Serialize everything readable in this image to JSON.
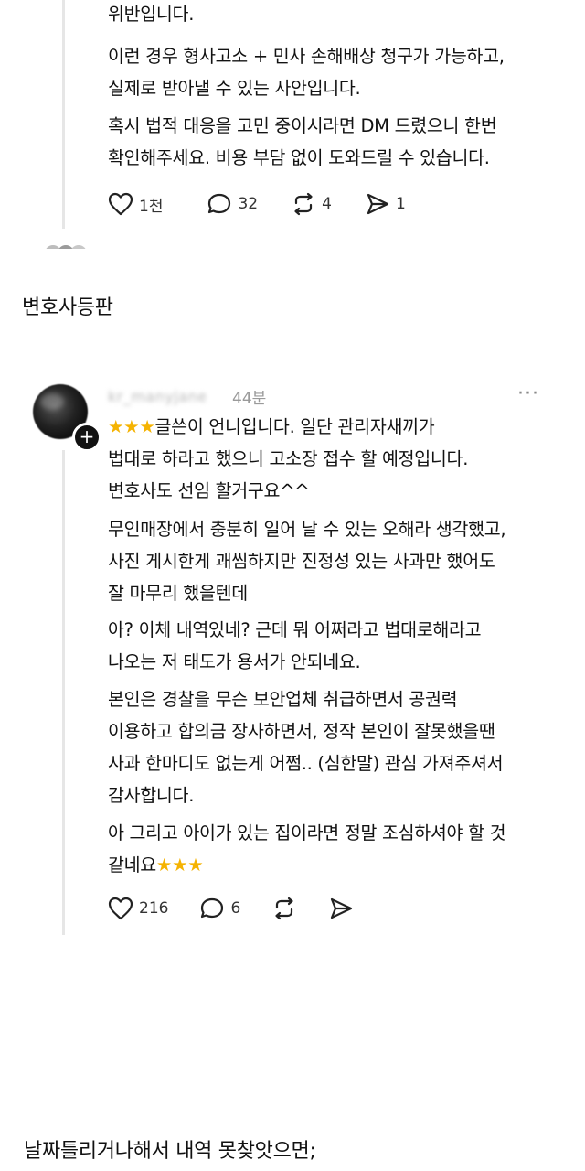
{
  "post1": {
    "paragraphs": [
      "위반입니다.",
      "이런 경우 형사고소 + 민사 손해배상 청구가 가능하고,\n실제로 받아낼 수 있는 사안입니다.",
      "혹시 법적 대응을 고민 중이시라면 DM 드렸으니 한번\n확인해주세요. 비용 부담 없이 도와드릴 수 있습니다."
    ],
    "likes": "1천",
    "comments": "32",
    "reposts": "4",
    "shares": "1"
  },
  "section_title": "변호사등판",
  "post2": {
    "username": "kr_manyjane",
    "time": "44분",
    "more": "···",
    "line1_suffix": "글쓴이 언니입니다. 일단 관리자새끼가",
    "line2_3": "법대로 하라고 했으니 고소장 접수 할 예정입니다.\n변호사도 선임 할거구요^^",
    "paragraphs": [
      "무인매장에서 충분히 일어 날 수 있는 오해라 생각했고,\n사진 게시한게 괘씸하지만 진정성 있는 사과만 했어도\n잘 마무리 했을텐데",
      "아? 이체 내역있네? 근데 뭐 어쩌라고 법대로해라고\n나오는 저 태도가 용서가 안되네요.",
      "본인은 경찰을 무슨 보안업체 취급하면서 공권력\n이용하고 합의금 장사하면서, 정작 본인이 잘못했을땐\n사과 한마디도 없는게 어쩜.. (심한말) 관심 가져주셔서\n감사합니다."
    ],
    "last_para": "아 그리고 아이가 있는 집이라면 정말 조심하셔야 할 것\n같네요",
    "stars": "★★★",
    "likes": "216",
    "comments": "6"
  },
  "bottom_caption": "날짜틀리거나해서 내역 못찾앗으면;"
}
